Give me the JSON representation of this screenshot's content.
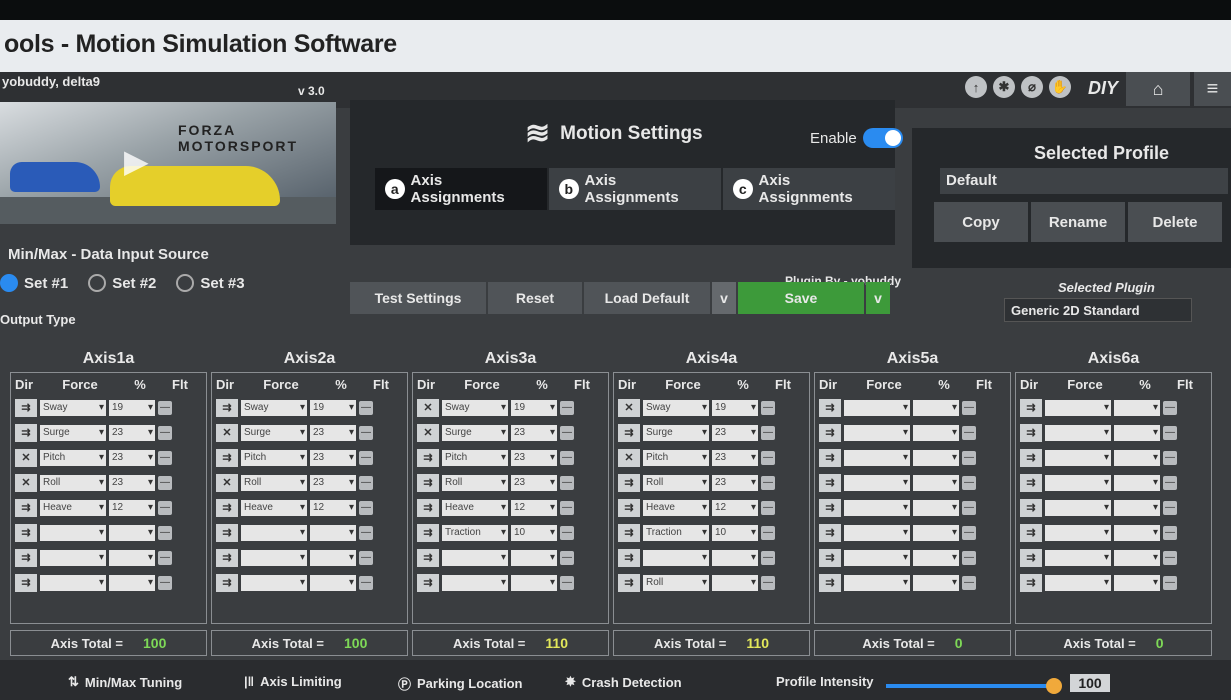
{
  "window": {
    "title": "ools - Motion Simulation Software"
  },
  "header": {
    "authors": "yobuddy, delta9",
    "version": "v 3.0",
    "diy": "DIY",
    "icons": [
      "up-arrow-icon",
      "gear-icon",
      "link-icon",
      "hand-icon"
    ]
  },
  "game": {
    "logo_line1": "FORZA",
    "logo_line2": "MOTORSPORT"
  },
  "motion": {
    "title": "Motion Settings",
    "enable_label": "Enable",
    "enabled": true,
    "tabs": [
      {
        "letter": "a",
        "label": "Axis Assignments"
      },
      {
        "letter": "b",
        "label": "Axis Assignments"
      },
      {
        "letter": "c",
        "label": "Axis Assignments"
      }
    ]
  },
  "profile": {
    "title": "Selected Profile",
    "value": "Default",
    "copy": "Copy",
    "rename": "Rename",
    "delete": "Delete"
  },
  "source": {
    "label": "Min/Max - Data Input Source",
    "sets": [
      "Set #1",
      "Set #2",
      "Set #3"
    ],
    "selected": "Set #1",
    "output_label": "Output Type"
  },
  "actions": {
    "test": "Test Settings",
    "reset": "Reset",
    "load_default": "Load Default",
    "save": "Save",
    "plugin_by": "Plugin By - yobuddy"
  },
  "plugin": {
    "label": "Selected Plugin",
    "value": "Generic 2D Standard"
  },
  "axis_headers": {
    "dir": "Dir",
    "force": "Force",
    "pct": "%",
    "flt": "Flt"
  },
  "axes": [
    {
      "name": "Axis1a",
      "total": "100",
      "total_color": "#7ed957",
      "rows": [
        [
          "Sway",
          "19",
          "straight"
        ],
        [
          "Surge",
          "23",
          "straight"
        ],
        [
          "Pitch",
          "23",
          "cross"
        ],
        [
          "Roll",
          "23",
          "cross"
        ],
        [
          "Heave",
          "12",
          "straight"
        ],
        [
          "",
          "",
          "straight"
        ],
        [
          "",
          "",
          "straight"
        ],
        [
          "",
          "",
          "straight"
        ]
      ]
    },
    {
      "name": "Axis2a",
      "total": "100",
      "total_color": "#7ed957",
      "rows": [
        [
          "Sway",
          "19",
          "straight"
        ],
        [
          "Surge",
          "23",
          "cross"
        ],
        [
          "Pitch",
          "23",
          "straight"
        ],
        [
          "Roll",
          "23",
          "cross"
        ],
        [
          "Heave",
          "12",
          "straight"
        ],
        [
          "",
          "",
          "straight"
        ],
        [
          "",
          "",
          "straight"
        ],
        [
          "",
          "",
          "straight"
        ]
      ]
    },
    {
      "name": "Axis3a",
      "total": "110",
      "total_color": "#e2e85a",
      "rows": [
        [
          "Sway",
          "19",
          "cross"
        ],
        [
          "Surge",
          "23",
          "cross"
        ],
        [
          "Pitch",
          "23",
          "straight"
        ],
        [
          "Roll",
          "23",
          "straight"
        ],
        [
          "Heave",
          "12",
          "straight"
        ],
        [
          "Traction",
          "10",
          "straight"
        ],
        [
          "",
          "",
          "straight"
        ],
        [
          "",
          "",
          "straight"
        ]
      ]
    },
    {
      "name": "Axis4a",
      "total": "110",
      "total_color": "#e2e85a",
      "rows": [
        [
          "Sway",
          "19",
          "cross"
        ],
        [
          "Surge",
          "23",
          "straight"
        ],
        [
          "Pitch",
          "23",
          "cross"
        ],
        [
          "Roll",
          "23",
          "straight"
        ],
        [
          "Heave",
          "12",
          "straight"
        ],
        [
          "Traction",
          "10",
          "straight"
        ],
        [
          "",
          "",
          "straight"
        ],
        [
          "Roll",
          "",
          "straight"
        ]
      ]
    },
    {
      "name": "Axis5a",
      "total": "0",
      "total_color": "#7ed957",
      "rows": [
        [
          "",
          "",
          "straight"
        ],
        [
          "",
          "",
          "straight"
        ],
        [
          "",
          "",
          "straight"
        ],
        [
          "",
          "",
          "straight"
        ],
        [
          "",
          "",
          "straight"
        ],
        [
          "",
          "",
          "straight"
        ],
        [
          "",
          "",
          "straight"
        ],
        [
          "",
          "",
          "straight"
        ]
      ]
    },
    {
      "name": "Axis6a",
      "total": "0",
      "total_color": "#7ed957",
      "rows": [
        [
          "",
          "",
          "straight"
        ],
        [
          "",
          "",
          "straight"
        ],
        [
          "",
          "",
          "straight"
        ],
        [
          "",
          "",
          "straight"
        ],
        [
          "",
          "",
          "straight"
        ],
        [
          "",
          "",
          "straight"
        ],
        [
          "",
          "",
          "straight"
        ],
        [
          "",
          "",
          "straight"
        ]
      ]
    }
  ],
  "total_label": "Axis Total =",
  "footer": {
    "minmax": "Min/Max Tuning",
    "limiting": "Axis Limiting",
    "parking": "Parking Location",
    "crash": "Crash Detection",
    "intensity_label": "Profile Intensity",
    "intensity": "100"
  }
}
